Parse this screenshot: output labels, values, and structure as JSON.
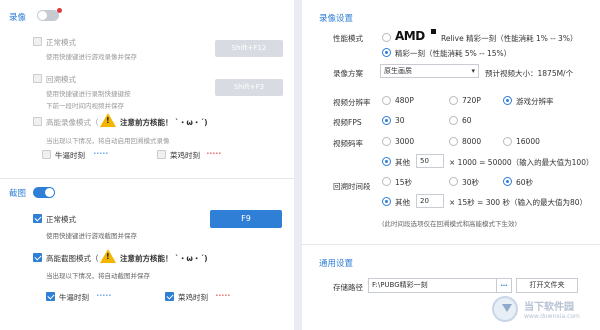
{
  "left": {
    "record": {
      "title": "录像",
      "normal_mode": {
        "label": "正常模式",
        "desc": "使用快捷键进行游戏录像并保存",
        "hotkey": "Shift+F12"
      },
      "replay_mode": {
        "label": "回溯模式",
        "desc1": "使用快捷键进行录制快捷键按",
        "desc2": "下前一段时间内视频并保存",
        "hotkey": "Shift+F3"
      },
      "smart_mode": {
        "label": "高能录像模式（",
        "warn_glyph": "!",
        "warn_text": "注意前方核能！ `・ω・´)",
        "desc": "当出现以下情况，将自动启用回溯模式录像"
      },
      "moments": {
        "kill_label": "牛逼时刻",
        "kill_wave": "ﾞﾞﾞﾞﾞ",
        "drop_label": "菜鸡时刻",
        "drop_wave": "ﾞﾞﾞﾞﾞ"
      }
    },
    "screenshot": {
      "title": "截图",
      "normal_mode": {
        "label": "正常模式",
        "desc": "使用快捷键进行游戏截图并保存",
        "hotkey": "F9"
      },
      "smart_mode": {
        "label": "高能截图模式（",
        "warn_glyph": "!",
        "warn_text": "注意前方核能！ `・ω・´)",
        "desc": "当出现以下情况，将自动截图并保存"
      },
      "moments": {
        "kill_label": "牛逼时刻",
        "kill_wave": "ﾞﾞﾞﾞﾞ",
        "drop_label": "菜鸡时刻",
        "drop_wave": "ﾞﾞﾞﾞﾞ"
      }
    }
  },
  "right": {
    "record_settings": {
      "title": "录像设置",
      "perf_mode": {
        "label": "性能模式",
        "amd_logo": "AMD",
        "amd_text": "Relive 精彩一刻（性能消耗 1% -- 3%）",
        "opt2": "精彩一刻（性能消耗 5% -- 15%）"
      },
      "scheme": {
        "label": "录像方案",
        "value": "原生画质",
        "est_label": "预计视频大小：1875M/个"
      },
      "resolution": {
        "label": "视频分辨率",
        "opts": [
          "480P",
          "720P",
          "游戏分辨率"
        ]
      },
      "fps": {
        "label": "视频FPS",
        "opts": [
          "30",
          "60"
        ]
      },
      "bitrate": {
        "label": "视频码率",
        "opts": [
          "3000",
          "8000",
          "16000"
        ],
        "other_label": "其他",
        "other_value": "50",
        "formula": "× 1000 = 50000（输入的最大值为100）"
      },
      "replay": {
        "label": "回溯时间段",
        "opts": [
          "15秒",
          "30秒",
          "60秒"
        ],
        "other_label": "其他",
        "other_value": "20",
        "formula": "× 15秒 = 300 秒（输入的最大值为80）"
      },
      "note": "(此时间段选项仅在回溯模式和高能模式下生效)"
    },
    "general": {
      "title": "通用设置",
      "path_label": "存储路径",
      "path_value": "F:\\PUBG精彩一刻",
      "browse": "…",
      "open_folder": "打开文件夹"
    },
    "watermark": {
      "main": "当下软件园",
      "sub": "www.downxia.com"
    }
  },
  "colors": {
    "accent": "#2f7fd6",
    "toggle_off": "#c6cbd2",
    "record_dot": "#e0393e"
  }
}
